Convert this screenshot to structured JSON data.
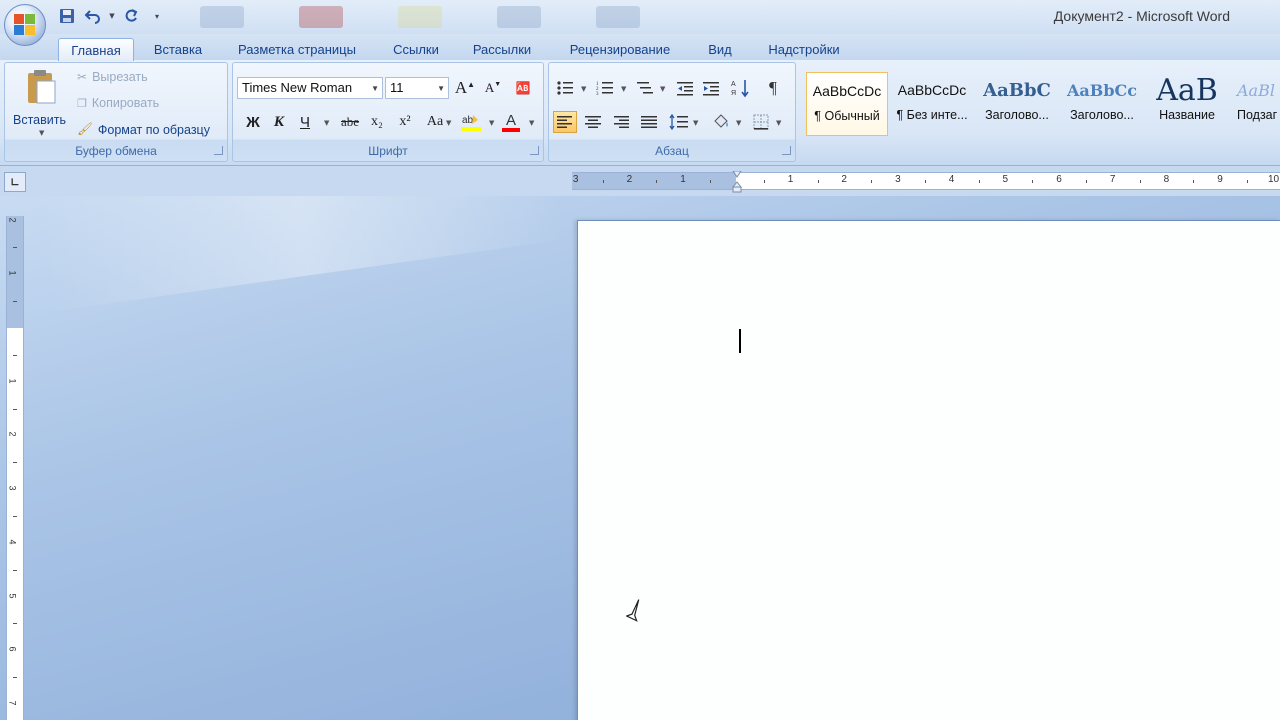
{
  "window": {
    "title": "Документ2 - Microsoft Word"
  },
  "qat": {
    "items": [
      "save-icon",
      "undo-icon",
      "redo-icon",
      "customize-icon"
    ]
  },
  "tabs": [
    {
      "label": "Главная",
      "active": true
    },
    {
      "label": "Вставка"
    },
    {
      "label": "Разметка страницы"
    },
    {
      "label": "Ссылки"
    },
    {
      "label": "Рассылки"
    },
    {
      "label": "Рецензирование"
    },
    {
      "label": "Вид"
    },
    {
      "label": "Надстройки"
    }
  ],
  "clipboard": {
    "paste": "Вставить",
    "cut": "Вырезать",
    "copy": "Копировать",
    "format_painter": "Формат по образцу",
    "label": "Буфер обмена"
  },
  "font": {
    "name": "Times New Roman",
    "size": "11",
    "bold": "Ж",
    "italic": "К",
    "underline": "Ч",
    "strike": "abe",
    "subscript": "x₂",
    "superscript": "x²",
    "change_case": "Aa",
    "grow": "A",
    "shrink": "A",
    "font_color": "A",
    "label": "Шрифт"
  },
  "paragraph": {
    "label": "Абзац",
    "pilcrow": "¶"
  },
  "styles": [
    {
      "preview": "AaBbCcDc",
      "name": "¶ Обычный",
      "selected": true
    },
    {
      "preview": "AaBbCcDc",
      "name": "¶ Без инте..."
    },
    {
      "preview": "AaBbC",
      "name": "Заголово..."
    },
    {
      "preview": "AaBbCc",
      "name": "Заголово..."
    },
    {
      "preview": "AaB",
      "name": "Название"
    },
    {
      "preview": "AaBl",
      "name": "Подзаг"
    }
  ],
  "ruler": {
    "labels": [
      "3",
      "2",
      "1",
      "1",
      "2",
      "3",
      "4",
      "5",
      "6",
      "7",
      "8",
      "9",
      "10"
    ],
    "vlabels": [
      "2",
      "1",
      "1",
      "2",
      "3",
      "4",
      "5",
      "6",
      "7"
    ]
  },
  "colors": {
    "accent": "#15428b",
    "highlight": "#ffff00",
    "font_color": "#ff0000",
    "selected_style_border": "#f1c15f"
  }
}
